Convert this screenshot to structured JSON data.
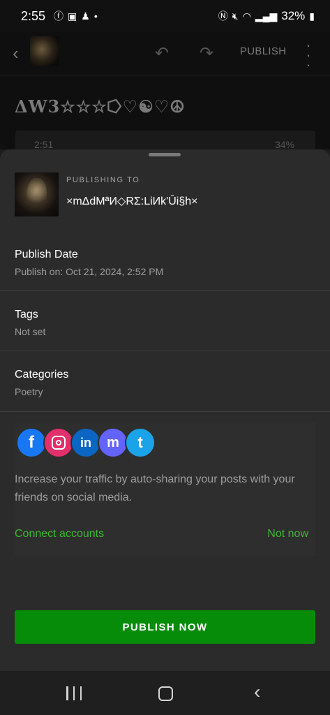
{
  "status_bar": {
    "time": "2:55",
    "left_icons": [
      "facebook-icon",
      "gallery-icon",
      "snapchat-icon",
      "dot-icon"
    ],
    "battery": "32%"
  },
  "app_bar": {
    "publish_label": "PUBLISH"
  },
  "background": {
    "post_title": "ΔW3☆☆☆⭔♡☯♡☮",
    "embedded_time": "2:51",
    "embedded_battery": "34%"
  },
  "sheet": {
    "publishing_to_label": "PUBLISHING TO",
    "site_name": "×mΔdMªИ◇RΣ:LiИk'Ūi§h×",
    "publish_date": {
      "label": "Publish Date",
      "value": "Publish on: Oct 21, 2024, 2:52 PM"
    },
    "tags": {
      "label": "Tags",
      "value": "Not set"
    },
    "categories": {
      "label": "Categories",
      "value": "Poetry"
    },
    "social": {
      "icons": [
        "facebook-icon",
        "instagram-icon",
        "linkedin-icon",
        "mastodon-icon",
        "tumblr-icon"
      ],
      "description": "Increase your traffic by auto-sharing your posts with your friends on social media.",
      "connect_label": "Connect accounts",
      "not_now_label": "Not now"
    },
    "publish_now_label": "PUBLISH NOW"
  },
  "colors": {
    "accent_green": "#078c0a",
    "link_green": "#3db834",
    "sheet_bg": "#2b2b2b"
  }
}
